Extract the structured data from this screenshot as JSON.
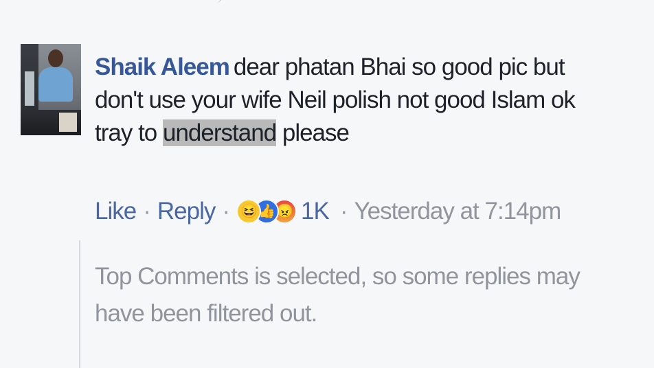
{
  "comment": {
    "author": "Shaik Aleem",
    "text_before_highlight": "dear phatan Bhai so good pic but don't use your wife Neil polish not good Islam ok tray to ",
    "highlighted_text": "understand",
    "text_after_highlight": " please"
  },
  "actions": {
    "like": "Like",
    "separator": "·",
    "reply": "Reply",
    "reaction_count": "1K",
    "timestamp": "Yesterday at 7:14pm",
    "reactions": [
      "haha-icon",
      "like-icon",
      "angry-icon"
    ]
  },
  "notice": {
    "text": "Top Comments is selected, so some replies may have been filtered out."
  },
  "colors": {
    "background": "#f6f7f9",
    "author": "#365899",
    "link": "#4b67a1",
    "meta": "#90949c",
    "body_text": "#1d2129",
    "highlight": "#b9b9b9"
  }
}
